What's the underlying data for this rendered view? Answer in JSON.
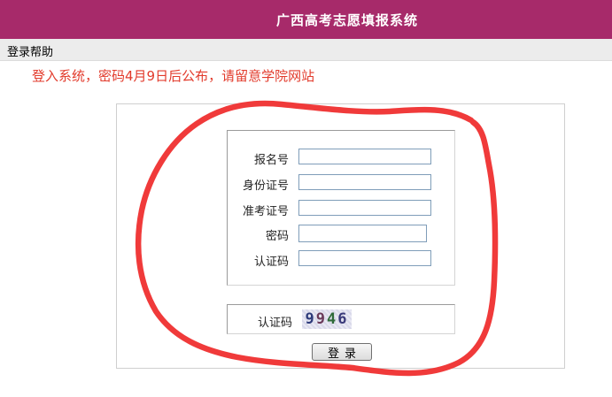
{
  "header": {
    "title": "广西高考志愿填报系统"
  },
  "menu": {
    "help_label": "登录帮助"
  },
  "notice": {
    "text": "登入系统，密码4月9日后公布，请留意学院网站"
  },
  "form": {
    "fields": [
      {
        "label": "报名号",
        "value": ""
      },
      {
        "label": "身份证号",
        "value": ""
      },
      {
        "label": "准考证号",
        "value": ""
      },
      {
        "label": "密码",
        "value": ""
      },
      {
        "label": "认证码",
        "value": ""
      }
    ]
  },
  "captcha": {
    "label": "认证码",
    "digits": [
      "9",
      "9",
      "4",
      "6"
    ]
  },
  "login": {
    "label": "登录"
  },
  "colors": {
    "header_bg": "#a72a6a",
    "notice_text": "#e23b2c",
    "annotation_stroke": "#f03a3a"
  }
}
